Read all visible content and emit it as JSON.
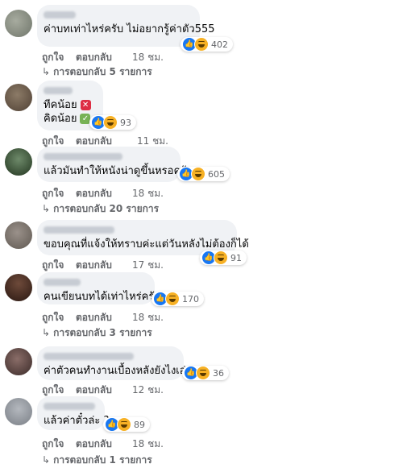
{
  "comments": [
    {
      "text": "ค่าบทเท่าไหร่ครับ ไม่อยากรู้ค่าตัว555",
      "reaction_count": "402",
      "like_label": "ถูกใจ",
      "reply_label": "ตอบกลับ",
      "time": "18 ชม.",
      "replies": "การตอบกลับ 5 รายการ",
      "avatar_color": "#8a8f84"
    },
    {
      "line1": "ทีคน้อย",
      "line2": "คิดน้อย",
      "emoji1": "cross-mark-icon",
      "emoji2": "check-mark-icon",
      "reaction_count": "93",
      "like_label": "ถูกใจ",
      "reply_label": "ตอบกลับ",
      "time": "11 ชม.",
      "avatar_color": "#6b5b4a"
    },
    {
      "text": "แล้วมันทำให้หนังน่าดูขึ้นหรอครับ",
      "reaction_count": "605",
      "like_label": "ถูกใจ",
      "reply_label": "ตอบกลับ",
      "time": "18 ชม.",
      "replies": "การตอบกลับ 20 รายการ",
      "avatar_color": "#3b5a3a"
    },
    {
      "text": "ขอบคุณที่แจ้งให้ทราบค่ะแต่วันหลังไม่ต้องก็ได้",
      "reaction_count": "91",
      "like_label": "ถูกใจ",
      "reply_label": "ตอบกลับ",
      "time": "17 ชม.",
      "avatar_color": "#7d756e"
    },
    {
      "text": "คนเขียนบทได้เท่าไหร่ครับ",
      "reaction_count": "170",
      "like_label": "ถูกใจ",
      "reply_label": "ตอบกลับ",
      "time": "18 ชม.",
      "replies": "การตอบกลับ 3 รายการ",
      "avatar_color": "#4a3028"
    },
    {
      "text": "ค่าตัวคนทำงานเบื้องหลังยังไงเอ่ย",
      "reaction_count": "36",
      "like_label": "ถูกใจ",
      "reply_label": "ตอบกลับ",
      "time": "12 ชม.",
      "avatar_color": "#5b4b48"
    },
    {
      "text": "แล้วค่าตั๋วล่ะ ?",
      "reaction_count": "89",
      "like_label": "ถูกใจ",
      "reply_label": "ตอบกลับ",
      "time": "18 ชม.",
      "replies": "การตอบกลับ 1 รายการ",
      "avatar_color": "#8c9199"
    }
  ]
}
